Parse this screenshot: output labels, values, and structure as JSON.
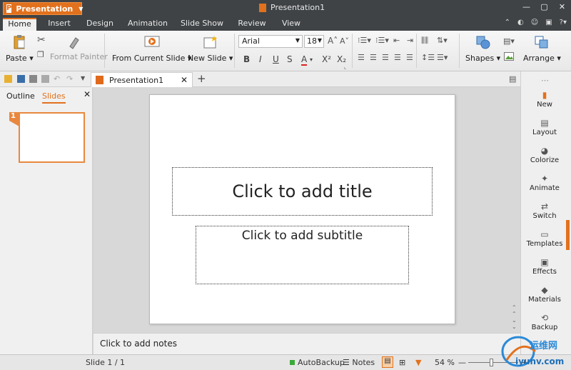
{
  "app": {
    "menu_label": "Presentation",
    "window_title": "Presentation1"
  },
  "tabs": [
    "Home",
    "Insert",
    "Design",
    "Animation",
    "Slide Show",
    "Review",
    "View"
  ],
  "ribbon": {
    "paste": "Paste",
    "format_painter": "Format Painter",
    "from_current_slide": "From Current Slide",
    "new_slide": "New Slide",
    "font_name": "Arial",
    "font_size": "18",
    "shapes": "Shapes",
    "arrange": "Arrange"
  },
  "doc_tab": "Presentation1",
  "left_panel": {
    "tab_outline": "Outline",
    "tab_slides": "Slides",
    "slide_number": "1"
  },
  "slide": {
    "title_placeholder": "Click to add title",
    "subtitle_placeholder": "Click to add subtitle"
  },
  "notes_placeholder": "Click to add notes",
  "task_pane": [
    "New",
    "Layout",
    "Colorize",
    "Animate",
    "Switch",
    "Templates",
    "Effects",
    "Materials",
    "Backup"
  ],
  "status": {
    "slide_position": "Slide 1 / 1",
    "autobackup": "AutoBackup",
    "notes": "Notes",
    "zoom": "54 %",
    "zoom_minus": "—",
    "zoom_plus": "+"
  },
  "watermark": {
    "cn": "运维网",
    "url": "iyunv.com"
  },
  "colors": {
    "accent": "#e2711d",
    "titlebar": "#3f4346"
  }
}
